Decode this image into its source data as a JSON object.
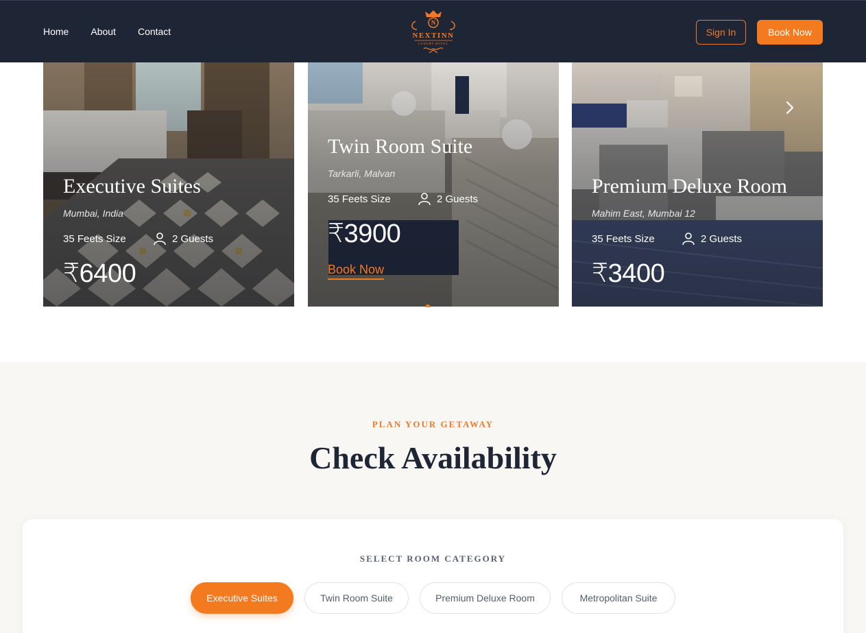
{
  "nav": {
    "links": [
      "Home",
      "About",
      "Contact"
    ],
    "logo_name": "NEXTINN",
    "logo_tagline": "LUXURY HOTEL",
    "signin_label": "Sign In",
    "book_label": "Book Now"
  },
  "rooms": [
    {
      "title": "Executive Suites",
      "location": "Mumbai, India",
      "size": "35  Feets Size",
      "guests": "2 Guests",
      "price": "₹6400"
    },
    {
      "title": "Twin Room Suite",
      "location": "Tarkarli, Malvan",
      "size": "35  Feets Size",
      "guests": "2 Guests",
      "price": "₹3900",
      "cta": "Book Now"
    },
    {
      "title": "Premium Deluxe Room",
      "location": "Mahim East, Mumbai 12",
      "size": "35  Feets Size",
      "guests": "2 Guests",
      "price": "₹3400"
    }
  ],
  "availability": {
    "eyebrow": "PLAN YOUR GETAWAY",
    "title": "Check Availability",
    "category_label": "SELECT ROOM CATEGORY",
    "categories": [
      "Executive Suites",
      "Twin Room Suite",
      "Premium Deluxe Room",
      "Metropolitan Suite"
    ],
    "selected": "Executive Suites"
  },
  "colors": {
    "navy": "#1e2636",
    "accent": "#f47a20",
    "section_bg": "#f9f7f4"
  },
  "icons": [
    "user-icon",
    "chevron-right-icon",
    "hotel-crest-logo"
  ]
}
